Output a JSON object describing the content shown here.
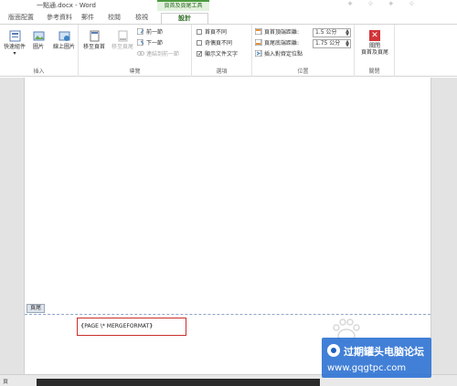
{
  "window": {
    "title": "一點通.docx - Word"
  },
  "ribbon_context": {
    "group_label": "頁首及頁尾工具"
  },
  "tabs": [
    "版面配置",
    "參考資料",
    "郵件",
    "校閱",
    "檢視",
    "設計"
  ],
  "groups": {
    "insert": {
      "label": "插入",
      "quick_parts": "快速組件",
      "picture": "圖片",
      "online_picture": "線上圖片"
    },
    "navigation": {
      "label": "導覽",
      "goto_header": "移至頁首",
      "goto_footer": "移至頁尾",
      "previous": "前一節",
      "next": "下一節",
      "link_previous": "連結到前一節"
    },
    "options": {
      "label": "選項",
      "different_first_page": "首頁不同",
      "different_odd_even": "奇偶頁不同",
      "show_document_text": "顯示文件文字",
      "show_document_text_checked": true
    },
    "position": {
      "label": "位置",
      "header_from_top_label": "頁首頂端距離:",
      "header_from_top_value": "1.5 公分",
      "footer_from_bottom_label": "頁尾底端距離:",
      "footer_from_bottom_value": "1.75 公分",
      "insert_alignment_tab": "插入對齊定位點"
    },
    "close": {
      "label": "關閉",
      "close_header_footer": "關閉\n頁首及頁尾"
    }
  },
  "document": {
    "footer_tag": "頁尾",
    "field_code": "PAGE   \\* MERGEFORMAT"
  },
  "statusbar": {
    "left_text": "頁"
  },
  "watermark": {
    "title": "过期罐头电脑论坛",
    "url": "www.gqgtpc.com"
  },
  "colors": {
    "context_green": "#4c9a3f",
    "close_red": "#d13438",
    "highlight_box": "#c9302c"
  }
}
